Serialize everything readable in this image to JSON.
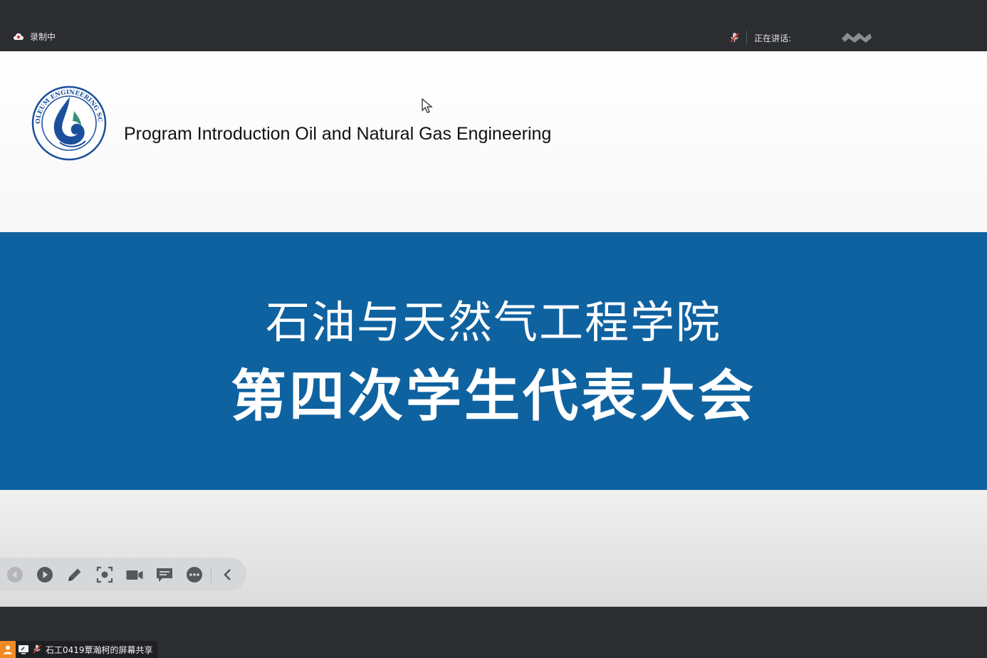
{
  "topbar": {
    "recording_label": "录制中",
    "speaking_label": "正在讲话:"
  },
  "slide": {
    "program_title": "Program Introduction Oil and Natural Gas Engineering",
    "logo_text": "PETROLEUM ENGINEERING SCHOOL",
    "banner_line1": "石油与天然气工程学院",
    "banner_line2": "第四次学生代表大会",
    "colors": {
      "banner": "#0f62a0",
      "logo_blue": "#1b4f9c",
      "logo_green": "#3a8f7a"
    }
  },
  "toolbar": {
    "items": [
      {
        "name": "previous-button",
        "icon": "prev-circle-icon"
      },
      {
        "name": "next-button",
        "icon": "play-circle-icon"
      },
      {
        "name": "pen-button",
        "icon": "pen-icon"
      },
      {
        "name": "screenshot-button",
        "icon": "focus-icon"
      },
      {
        "name": "camera-button",
        "icon": "video-camera-icon"
      },
      {
        "name": "chat-button",
        "icon": "chat-icon"
      },
      {
        "name": "more-button",
        "icon": "more-icon"
      },
      {
        "name": "collapse-button",
        "icon": "chevron-left-icon"
      }
    ]
  },
  "bottombar": {
    "share_label": "石工0419覃瀚柯的屏幕共享"
  }
}
